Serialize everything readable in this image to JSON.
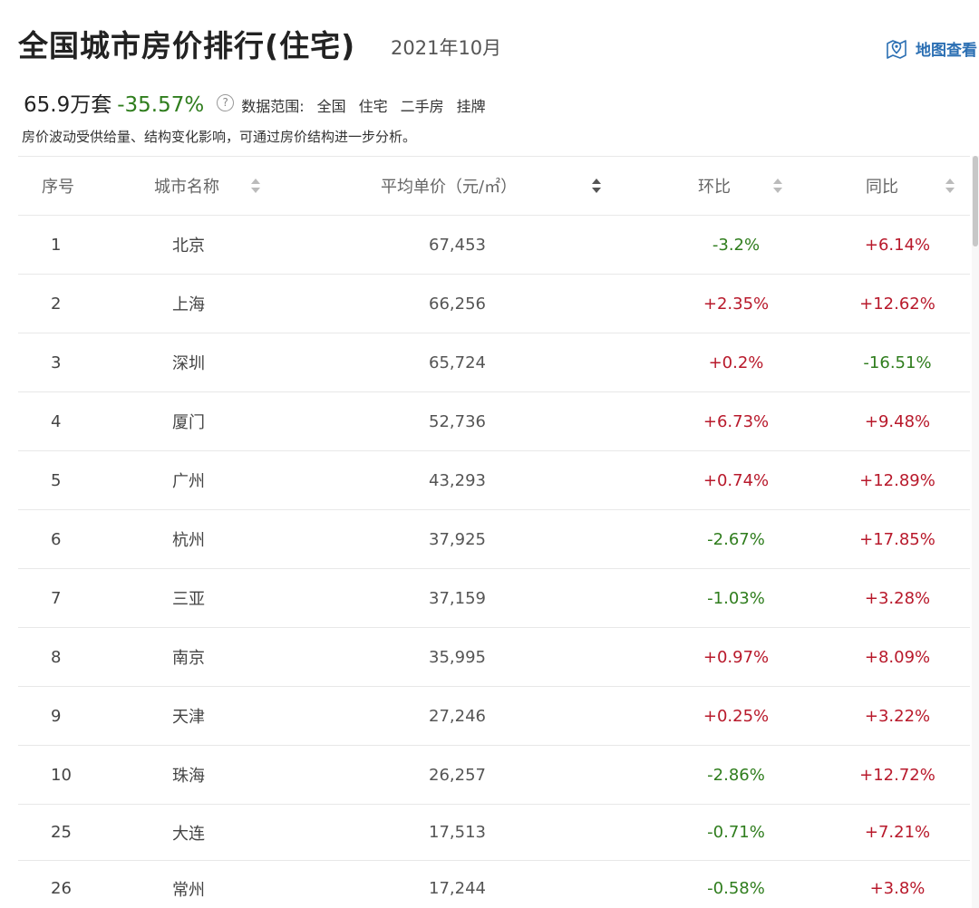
{
  "header": {
    "title": "全国城市房价排行(住宅)",
    "month": "2021年10月",
    "map_link": "地图查看",
    "map_icon": "map-pin-icon"
  },
  "summary": {
    "count": "65.9万套",
    "change": "-35.57%",
    "help_icon": "?",
    "scope_label": "数据范围:",
    "scope_items": [
      "全国",
      "住宅",
      "二手房",
      "挂牌"
    ]
  },
  "note": "房价波动受供给量、结构变化影响，可通过房价结构进一步分析。",
  "table": {
    "columns": [
      "序号",
      "城市名称",
      "平均单价（元/㎡）",
      "环比",
      "同比"
    ],
    "rows": [
      {
        "rank": "1",
        "city": "北京",
        "price": "67,453",
        "mom": "-3.2%",
        "yoy": "+6.14%"
      },
      {
        "rank": "2",
        "city": "上海",
        "price": "66,256",
        "mom": "+2.35%",
        "yoy": "+12.62%"
      },
      {
        "rank": "3",
        "city": "深圳",
        "price": "65,724",
        "mom": "+0.2%",
        "yoy": "-16.51%"
      },
      {
        "rank": "4",
        "city": "厦门",
        "price": "52,736",
        "mom": "+6.73%",
        "yoy": "+9.48%"
      },
      {
        "rank": "5",
        "city": "广州",
        "price": "43,293",
        "mom": "+0.74%",
        "yoy": "+12.89%"
      },
      {
        "rank": "6",
        "city": "杭州",
        "price": "37,925",
        "mom": "-2.67%",
        "yoy": "+17.85%"
      },
      {
        "rank": "7",
        "city": "三亚",
        "price": "37,159",
        "mom": "-1.03%",
        "yoy": "+3.28%"
      },
      {
        "rank": "8",
        "city": "南京",
        "price": "35,995",
        "mom": "+0.97%",
        "yoy": "+8.09%"
      },
      {
        "rank": "9",
        "city": "天津",
        "price": "27,246",
        "mom": "+0.25%",
        "yoy": "+3.22%"
      },
      {
        "rank": "10",
        "city": "珠海",
        "price": "26,257",
        "mom": "-2.86%",
        "yoy": "+12.72%"
      },
      {
        "rank": "25",
        "city": "大连",
        "price": "17,513",
        "mom": "-0.71%",
        "yoy": "+7.21%"
      },
      {
        "rank": "26",
        "city": "常州",
        "price": "17,244",
        "mom": "-0.58%",
        "yoy": "+3.8%"
      }
    ]
  },
  "colors": {
    "up": "#b8192b",
    "down": "#2f7d1d",
    "link": "#2b6fb3"
  }
}
